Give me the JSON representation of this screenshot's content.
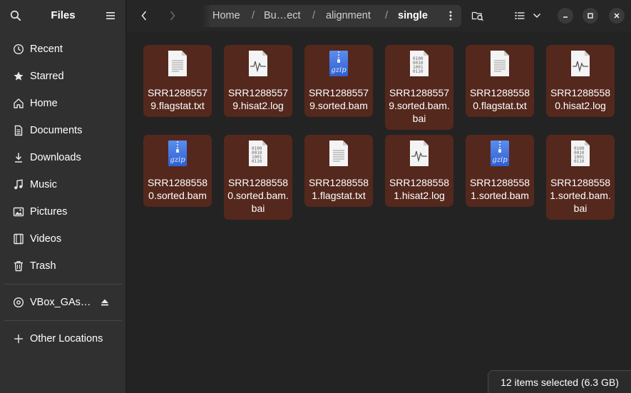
{
  "window": {
    "sidebar_title": "Files"
  },
  "sidebar": {
    "places": [
      {
        "label": "Recent",
        "icon": "clock-icon"
      },
      {
        "label": "Starred",
        "icon": "star-icon"
      },
      {
        "label": "Home",
        "icon": "home-icon"
      },
      {
        "label": "Documents",
        "icon": "document-icon"
      },
      {
        "label": "Downloads",
        "icon": "download-icon"
      },
      {
        "label": "Music",
        "icon": "music-icon"
      },
      {
        "label": "Pictures",
        "icon": "picture-icon"
      },
      {
        "label": "Videos",
        "icon": "video-icon"
      },
      {
        "label": "Trash",
        "icon": "trash-icon"
      }
    ],
    "devices": [
      {
        "label": "VBox_GAs…",
        "icon": "disc-icon"
      }
    ],
    "other": {
      "label": "Other Locations",
      "icon": "plus-icon"
    }
  },
  "pathbar": {
    "crumbs": [
      "Home",
      "Bu…ect",
      "alignment",
      "single"
    ],
    "separator": "/"
  },
  "files": [
    {
      "name": "SRR12885579.flagstat.txt",
      "type": "text"
    },
    {
      "name": "SRR12885579.hisat2.log",
      "type": "log"
    },
    {
      "name": "SRR12885579.sorted.bam",
      "type": "gzip"
    },
    {
      "name": "SRR12885579.sorted.bam.bai",
      "type": "binary"
    },
    {
      "name": "SRR12885580.flagstat.txt",
      "type": "text"
    },
    {
      "name": "SRR12885580.hisat2.log",
      "type": "log"
    },
    {
      "name": "SRR12885580.sorted.bam",
      "type": "gzip"
    },
    {
      "name": "SRR12885580.sorted.bam.bai",
      "type": "binary"
    },
    {
      "name": "SRR12885581.flagstat.txt",
      "type": "text"
    },
    {
      "name": "SRR12885581.hisat2.log",
      "type": "log"
    },
    {
      "name": "SRR12885581.sorted.bam",
      "type": "gzip"
    },
    {
      "name": "SRR12885581.sorted.bam.bai",
      "type": "binary"
    }
  ],
  "status": {
    "text": "12 items selected  (6.3 GB)"
  },
  "colors": {
    "selection": "#55281d",
    "sidebar_bg": "#303030",
    "content_bg": "#232323",
    "gzip_blue": "#3f6fe0"
  }
}
